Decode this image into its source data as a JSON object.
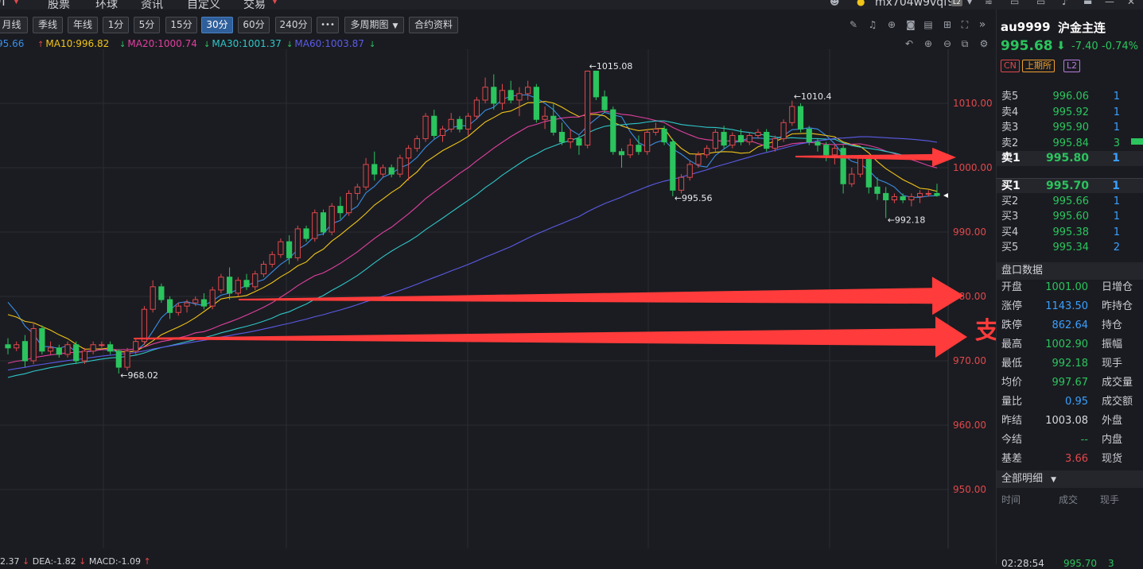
{
  "topnav": {
    "items": [
      "Л",
      "股票",
      "环球",
      "资讯",
      "自定义",
      "交易"
    ],
    "user": "mx704w9vqf9",
    "user_badge": "L2"
  },
  "toolbar": {
    "periods": [
      "月线",
      "季线",
      "年线",
      "1分",
      "5分",
      "15分",
      "30分",
      "60分",
      "240分"
    ],
    "active_period": "30分",
    "more": "•••",
    "multi_period": "多周期图",
    "contract_info": "合约资料"
  },
  "ma_legend": [
    {
      "label": "95.66",
      "color": "#3a8ee6",
      "arrow": ""
    },
    {
      "label": "MA10:996.82",
      "color": "#f0c419",
      "arrow": "↑"
    },
    {
      "label": "MA20:1000.74",
      "color": "#e040a0",
      "arrow": "↓"
    },
    {
      "label": "MA30:1001.37",
      "color": "#2ec6c8",
      "arrow": "↓"
    },
    {
      "label": "MA60:1003.87",
      "color": "#5b5be8",
      "arrow": "↓"
    },
    {
      "label": "",
      "color": "#2bc45e",
      "arrow": "↓"
    }
  ],
  "price_axis": {
    "ticks": [
      "1010.00",
      "1000.00",
      "990.00",
      "980.00",
      "970.00",
      "960.00",
      "950.00"
    ],
    "color": "#e0484c"
  },
  "annotations": {
    "high": "←1015.08",
    "high2": "←1010.4",
    "low1": "←995.56",
    "low2": "←992.18",
    "low3": "←968.02",
    "support_text": "支撑位",
    "arrow_color": "#ff3b3b"
  },
  "bottom_legend": {
    "text": "2.37",
    "dea": "DEA:-1.82",
    "macd": "MACD:-1.09"
  },
  "chart_data": {
    "type": "candlestick",
    "period": "30分",
    "ylim": [
      945,
      1020
    ],
    "candles": [
      {
        "o": 972.5,
        "h": 973.5,
        "l": 971.0,
        "c": 972.0
      },
      {
        "o": 972.0,
        "h": 973.0,
        "l": 971.5,
        "c": 972.5
      },
      {
        "o": 973.0,
        "h": 974.0,
        "l": 969.0,
        "c": 970.0
      },
      {
        "o": 970.0,
        "h": 976.0,
        "l": 969.5,
        "c": 975.0
      },
      {
        "o": 975.0,
        "h": 975.5,
        "l": 971.0,
        "c": 971.5
      },
      {
        "o": 971.5,
        "h": 973.0,
        "l": 971.0,
        "c": 972.0
      },
      {
        "o": 972.0,
        "h": 972.5,
        "l": 970.5,
        "c": 971.0
      },
      {
        "o": 971.0,
        "h": 973.0,
        "l": 970.5,
        "c": 972.5
      },
      {
        "o": 972.5,
        "h": 973.0,
        "l": 969.5,
        "c": 970.0
      },
      {
        "o": 970.0,
        "h": 972.0,
        "l": 969.5,
        "c": 971.5
      },
      {
        "o": 971.5,
        "h": 973.0,
        "l": 971.0,
        "c": 972.5
      },
      {
        "o": 972.5,
        "h": 973.0,
        "l": 972.0,
        "c": 972.5
      },
      {
        "o": 972.5,
        "h": 973.0,
        "l": 971.0,
        "c": 971.5
      },
      {
        "o": 971.5,
        "h": 971.8,
        "l": 968.02,
        "c": 969.0
      },
      {
        "o": 969.0,
        "h": 972.0,
        "l": 968.5,
        "c": 971.5
      },
      {
        "o": 971.5,
        "h": 973.5,
        "l": 971.0,
        "c": 973.0
      },
      {
        "o": 973.0,
        "h": 978.5,
        "l": 972.5,
        "c": 978.0
      },
      {
        "o": 978.0,
        "h": 982.5,
        "l": 977.5,
        "c": 981.5
      },
      {
        "o": 981.5,
        "h": 982.0,
        "l": 979.0,
        "c": 979.5
      },
      {
        "o": 979.5,
        "h": 980.0,
        "l": 976.5,
        "c": 977.5
      },
      {
        "o": 977.5,
        "h": 979.0,
        "l": 977.0,
        "c": 978.5
      },
      {
        "o": 978.5,
        "h": 979.5,
        "l": 977.5,
        "c": 979.0
      },
      {
        "o": 979.0,
        "h": 980.0,
        "l": 978.5,
        "c": 979.5
      },
      {
        "o": 979.5,
        "h": 980.5,
        "l": 978.0,
        "c": 978.5
      },
      {
        "o": 978.5,
        "h": 981.5,
        "l": 978.0,
        "c": 981.0
      },
      {
        "o": 981.0,
        "h": 983.5,
        "l": 980.5,
        "c": 983.0
      },
      {
        "o": 983.0,
        "h": 984.5,
        "l": 979.5,
        "c": 980.5
      },
      {
        "o": 980.5,
        "h": 983.0,
        "l": 980.0,
        "c": 982.5
      },
      {
        "o": 982.5,
        "h": 983.5,
        "l": 981.0,
        "c": 981.5
      },
      {
        "o": 981.5,
        "h": 984.0,
        "l": 981.0,
        "c": 983.5
      },
      {
        "o": 983.5,
        "h": 985.5,
        "l": 983.0,
        "c": 985.0
      },
      {
        "o": 985.0,
        "h": 987.0,
        "l": 984.5,
        "c": 986.5
      },
      {
        "o": 986.5,
        "h": 989.0,
        "l": 986.0,
        "c": 988.5
      },
      {
        "o": 988.5,
        "h": 989.5,
        "l": 985.0,
        "c": 986.0
      },
      {
        "o": 986.0,
        "h": 991.0,
        "l": 985.5,
        "c": 990.5
      },
      {
        "o": 990.5,
        "h": 991.0,
        "l": 988.5,
        "c": 989.0
      },
      {
        "o": 989.0,
        "h": 993.5,
        "l": 988.5,
        "c": 993.0
      },
      {
        "o": 993.0,
        "h": 993.5,
        "l": 989.5,
        "c": 990.0
      },
      {
        "o": 990.0,
        "h": 994.5,
        "l": 989.5,
        "c": 994.0
      },
      {
        "o": 994.0,
        "h": 995.5,
        "l": 992.0,
        "c": 993.0
      },
      {
        "o": 993.0,
        "h": 996.5,
        "l": 992.5,
        "c": 996.0
      },
      {
        "o": 996.0,
        "h": 997.5,
        "l": 995.0,
        "c": 997.0
      },
      {
        "o": 997.0,
        "h": 1001.5,
        "l": 996.5,
        "c": 1000.5
      },
      {
        "o": 1000.5,
        "h": 1002.5,
        "l": 998.0,
        "c": 999.0
      },
      {
        "o": 999.0,
        "h": 1000.5,
        "l": 998.5,
        "c": 1000.0
      },
      {
        "o": 1000.0,
        "h": 1000.5,
        "l": 998.5,
        "c": 999.0
      },
      {
        "o": 999.0,
        "h": 1002.0,
        "l": 998.5,
        "c": 1001.5
      },
      {
        "o": 1001.5,
        "h": 1003.5,
        "l": 998.0,
        "c": 1003.0
      },
      {
        "o": 1003.0,
        "h": 1005.0,
        "l": 1002.5,
        "c": 1004.5
      },
      {
        "o": 1004.5,
        "h": 1008.5,
        "l": 1004.0,
        "c": 1008.0
      },
      {
        "o": 1008.0,
        "h": 1009.0,
        "l": 1004.5,
        "c": 1005.0
      },
      {
        "o": 1005.0,
        "h": 1006.5,
        "l": 1004.0,
        "c": 1006.0
      },
      {
        "o": 1006.0,
        "h": 1008.5,
        "l": 1005.5,
        "c": 1007.5
      },
      {
        "o": 1007.5,
        "h": 1008.0,
        "l": 1005.5,
        "c": 1006.0
      },
      {
        "o": 1006.0,
        "h": 1008.5,
        "l": 1005.0,
        "c": 1008.0
      },
      {
        "o": 1008.0,
        "h": 1011.0,
        "l": 1007.5,
        "c": 1010.5
      },
      {
        "o": 1010.5,
        "h": 1014.0,
        "l": 1010.0,
        "c": 1012.5
      },
      {
        "o": 1012.5,
        "h": 1014.5,
        "l": 1009.0,
        "c": 1010.0
      },
      {
        "o": 1010.0,
        "h": 1013.0,
        "l": 1009.0,
        "c": 1012.0
      },
      {
        "o": 1012.0,
        "h": 1013.5,
        "l": 1010.0,
        "c": 1010.5
      },
      {
        "o": 1010.5,
        "h": 1012.5,
        "l": 1008.0,
        "c": 1011.5
      },
      {
        "o": 1011.5,
        "h": 1013.5,
        "l": 1010.5,
        "c": 1012.5
      },
      {
        "o": 1012.5,
        "h": 1013.0,
        "l": 1007.0,
        "c": 1007.5
      },
      {
        "o": 1007.5,
        "h": 1009.5,
        "l": 1006.0,
        "c": 1008.0
      },
      {
        "o": 1008.0,
        "h": 1010.0,
        "l": 1005.0,
        "c": 1005.5
      },
      {
        "o": 1005.5,
        "h": 1007.0,
        "l": 1003.5,
        "c": 1004.0
      },
      {
        "o": 1004.0,
        "h": 1006.0,
        "l": 1003.0,
        "c": 1004.5
      },
      {
        "o": 1004.5,
        "h": 1005.0,
        "l": 1002.0,
        "c": 1003.5
      },
      {
        "o": 1003.5,
        "h": 1015.08,
        "l": 1003.0,
        "c": 1015.0
      },
      {
        "o": 1015.0,
        "h": 1015.0,
        "l": 1010.5,
        "c": 1011.0
      },
      {
        "o": 1011.0,
        "h": 1012.0,
        "l": 1008.5,
        "c": 1009.0
      },
      {
        "o": 1009.0,
        "h": 1009.5,
        "l": 1002.0,
        "c": 1002.5
      },
      {
        "o": 1002.5,
        "h": 1003.0,
        "l": 1000.0,
        "c": 1002.0
      },
      {
        "o": 1002.0,
        "h": 1004.5,
        "l": 1001.5,
        "c": 1003.5
      },
      {
        "o": 1003.5,
        "h": 1005.0,
        "l": 1002.0,
        "c": 1002.5
      },
      {
        "o": 1002.5,
        "h": 1006.0,
        "l": 1002.0,
        "c": 1005.5
      },
      {
        "o": 1005.5,
        "h": 1007.0,
        "l": 1005.0,
        "c": 1006.0
      },
      {
        "o": 1006.0,
        "h": 1006.5,
        "l": 1003.5,
        "c": 1004.0
      },
      {
        "o": 1004.0,
        "h": 1004.5,
        "l": 995.56,
        "c": 996.5
      },
      {
        "o": 996.5,
        "h": 999.0,
        "l": 996.0,
        "c": 998.5
      },
      {
        "o": 998.5,
        "h": 1001.0,
        "l": 998.0,
        "c": 1000.5
      },
      {
        "o": 1000.5,
        "h": 1002.5,
        "l": 1000.0,
        "c": 1002.0
      },
      {
        "o": 1002.0,
        "h": 1003.5,
        "l": 1001.5,
        "c": 1003.0
      },
      {
        "o": 1003.0,
        "h": 1006.0,
        "l": 1002.5,
        "c": 1005.5
      },
      {
        "o": 1005.5,
        "h": 1006.5,
        "l": 1003.0,
        "c": 1003.5
      },
      {
        "o": 1003.5,
        "h": 1005.5,
        "l": 1003.0,
        "c": 1005.0
      },
      {
        "o": 1005.0,
        "h": 1006.0,
        "l": 1003.5,
        "c": 1004.0
      },
      {
        "o": 1004.0,
        "h": 1005.5,
        "l": 1003.5,
        "c": 1005.0
      },
      {
        "o": 1005.0,
        "h": 1006.0,
        "l": 1004.5,
        "c": 1005.5
      },
      {
        "o": 1005.5,
        "h": 1006.0,
        "l": 1002.5,
        "c": 1003.0
      },
      {
        "o": 1003.0,
        "h": 1005.0,
        "l": 1002.5,
        "c": 1004.5
      },
      {
        "o": 1004.5,
        "h": 1007.5,
        "l": 1004.0,
        "c": 1007.0
      },
      {
        "o": 1007.0,
        "h": 1010.4,
        "l": 1006.5,
        "c": 1009.5
      },
      {
        "o": 1009.5,
        "h": 1010.0,
        "l": 1005.5,
        "c": 1006.0
      },
      {
        "o": 1006.0,
        "h": 1006.5,
        "l": 1003.5,
        "c": 1004.0
      },
      {
        "o": 1004.0,
        "h": 1004.5,
        "l": 1002.5,
        "c": 1003.5
      },
      {
        "o": 1003.5,
        "h": 1004.0,
        "l": 1001.0,
        "c": 1002.0
      },
      {
        "o": 1002.0,
        "h": 1003.5,
        "l": 1000.5,
        "c": 1003.0
      },
      {
        "o": 1003.0,
        "h": 1003.5,
        "l": 996.0,
        "c": 997.5
      },
      {
        "o": 997.5,
        "h": 1000.0,
        "l": 997.0,
        "c": 999.0
      },
      {
        "o": 999.0,
        "h": 1002.0,
        "l": 998.5,
        "c": 1001.5
      },
      {
        "o": 1001.5,
        "h": 1002.0,
        "l": 996.0,
        "c": 997.0
      },
      {
        "o": 997.0,
        "h": 998.5,
        "l": 995.0,
        "c": 996.0
      },
      {
        "o": 996.0,
        "h": 997.0,
        "l": 992.18,
        "c": 995.0
      },
      {
        "o": 995.0,
        "h": 996.0,
        "l": 994.5,
        "c": 995.5
      },
      {
        "o": 995.5,
        "h": 996.0,
        "l": 994.5,
        "c": 995.0
      },
      {
        "o": 995.0,
        "h": 996.0,
        "l": 994.0,
        "c": 995.5
      },
      {
        "o": 995.5,
        "h": 996.5,
        "l": 994.5,
        "c": 996.0
      },
      {
        "o": 996.0,
        "h": 996.5,
        "l": 995.5,
        "c": 996.0
      },
      {
        "o": 996.0,
        "h": 997.5,
        "l": 995.5,
        "c": 995.68
      }
    ]
  },
  "side": {
    "code": "au9999",
    "name": "沪金主连",
    "price": "995.68",
    "change": "-7.40",
    "change_pct": "-0.74%",
    "badges": [
      "CN",
      "上期所",
      "L2"
    ],
    "asks": [
      {
        "label": "卖5",
        "price": "996.06",
        "vol": "1"
      },
      {
        "label": "卖4",
        "price": "995.92",
        "vol": "1"
      },
      {
        "label": "卖3",
        "price": "995.90",
        "vol": "1"
      },
      {
        "label": "卖2",
        "price": "995.84",
        "vol": "3"
      },
      {
        "label": "卖1",
        "price": "995.80",
        "vol": "1"
      }
    ],
    "bids": [
      {
        "label": "买1",
        "price": "995.70",
        "vol": "1"
      },
      {
        "label": "买2",
        "price": "995.66",
        "vol": "1"
      },
      {
        "label": "买3",
        "price": "995.60",
        "vol": "1"
      },
      {
        "label": "买4",
        "price": "995.38",
        "vol": "1"
      },
      {
        "label": "买5",
        "price": "995.34",
        "vol": "2"
      }
    ],
    "panel_title": "盘口数据",
    "stats": [
      {
        "k": "开盘",
        "v": "1001.00",
        "color": "#2bc45e",
        "k2": "日增仓"
      },
      {
        "k": "涨停",
        "v": "1143.50",
        "color": "#3aa0ff",
        "k2": "昨持仓"
      },
      {
        "k": "跌停",
        "v": "862.64",
        "color": "#3aa0ff",
        "k2": "持仓"
      },
      {
        "k": "最高",
        "v": "1002.90",
        "color": "#2bc45e",
        "k2": "振幅"
      },
      {
        "k": "最低",
        "v": "992.18",
        "color": "#2bc45e",
        "k2": "现手"
      },
      {
        "k": "均价",
        "v": "997.67",
        "color": "#2bc45e",
        "k2": "成交量"
      },
      {
        "k": "量比",
        "v": "0.95",
        "color": "#3aa0ff",
        "k2": "成交额"
      },
      {
        "k": "昨结",
        "v": "1003.08",
        "color": "#d8dade",
        "k2": "外盘"
      },
      {
        "k": "今结",
        "v": "--",
        "color": "#2bc45e",
        "k2": "内盘"
      },
      {
        "k": "基差",
        "v": "3.66",
        "color": "#e0484c",
        "k2": "现货"
      }
    ],
    "detail_title": "全部明细",
    "detail_headers": [
      "时间",
      "成交",
      "现手"
    ],
    "last_row": {
      "time": "02:28:54",
      "price": "995.70",
      "vol": "3"
    }
  }
}
